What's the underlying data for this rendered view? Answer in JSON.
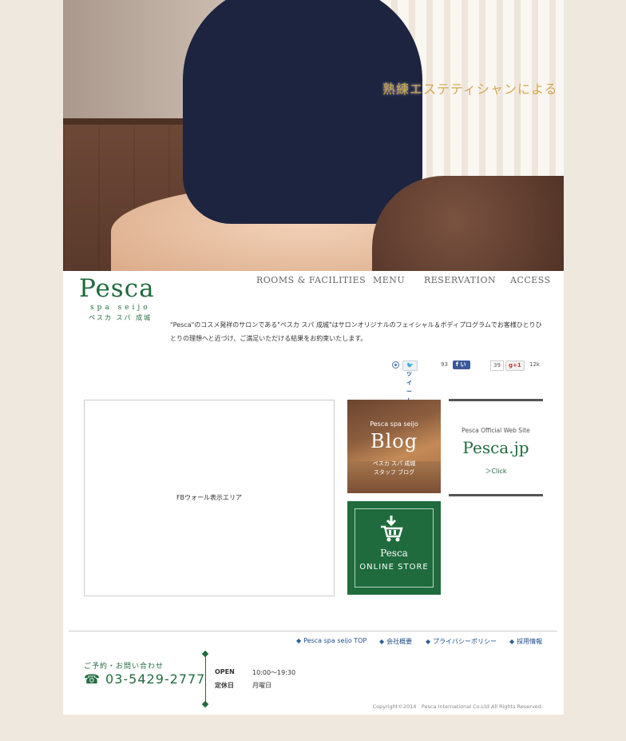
{
  "hero": {
    "caption": "熟練エステティシャンによる"
  },
  "logo": {
    "main": "Pesca",
    "sub": "spa seijo",
    "jp": "ペスカ スパ 成城"
  },
  "nav": {
    "items": [
      {
        "label": "ROOMS & FACILITIES"
      },
      {
        "label": "MENU"
      },
      {
        "label": "RESERVATION"
      },
      {
        "label": "ACCESS"
      }
    ]
  },
  "intro": {
    "text": "\"Pesca\"のコスメ発祥のサロンである\"ペスカ スパ 成城\"はサロンオリジナルのフェイシャル＆ボディプログラムでお客様ひとりひとりの理想へと近づけ、ご満足いただける結果をお約束いたします。"
  },
  "social": {
    "tweet_label": "ツイート",
    "tweet_count": "93",
    "like_label": "いいね！",
    "like_count": "39",
    "gplus_label": "+1",
    "gplus_count": "12k"
  },
  "fb_wall": {
    "placeholder": "FBウォール表示エリア"
  },
  "blog": {
    "small": "Pesca spa seijo",
    "big": "Blog",
    "jp_line1": "ペスカ スパ 成城",
    "jp_line2": "スタッフ ブログ"
  },
  "official": {
    "small": "Pesca Official Web Site",
    "big": "Pesca.jp",
    "click": "＞Click"
  },
  "store": {
    "brand": "Pesca",
    "label": "ONLINE STORE"
  },
  "footer": {
    "links": [
      {
        "label": "Pesca spa seijo TOP"
      },
      {
        "label": "会社概要"
      },
      {
        "label": "プライバシーポリシー"
      },
      {
        "label": "採用情報"
      }
    ],
    "contact_label": "ご予約・お問い合わせ",
    "phone": "☎ 03-5429-2777",
    "open_label": "OPEN",
    "open_value": "10:00〜19:30",
    "closed_label": "定休日",
    "closed_value": "月曜日",
    "copyright": "Copyright©2014　Pesca International Co.Ltd All Rights Reserved."
  },
  "colors": {
    "brand_green": "#1f6b3d",
    "page_bg": "#efe8de",
    "link_blue": "#1a4e8c"
  }
}
